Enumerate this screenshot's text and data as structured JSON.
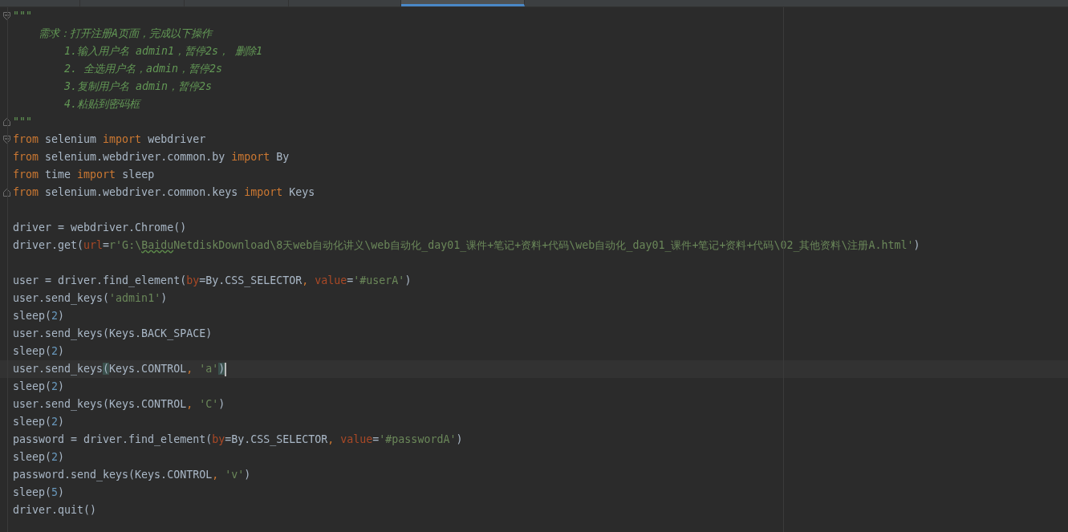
{
  "tabs": [
    {
      "selected": false
    },
    {
      "selected": false
    },
    {
      "selected": false
    },
    {
      "selected": false
    },
    {
      "selected": true
    }
  ],
  "editor": {
    "lines": [
      {
        "kind": "code",
        "current": false,
        "gutter": {
          "kind": "fold-start"
        },
        "tokens": [
          {
            "kind": "doc",
            "text": "\"\"\""
          }
        ]
      },
      {
        "kind": "code",
        "current": false,
        "tokens": [
          {
            "kind": "doc",
            "text": "    需求：打开注册A页面，完成以下操作"
          }
        ]
      },
      {
        "kind": "code",
        "current": false,
        "tokens": [
          {
            "kind": "doc",
            "text": "        1.输入用户名 admin1，暂停2s， 删除1"
          }
        ]
      },
      {
        "kind": "code",
        "current": false,
        "tokens": [
          {
            "kind": "doc",
            "text": "        2. 全选用户名，admin，暂停2s"
          }
        ]
      },
      {
        "kind": "code",
        "current": false,
        "tokens": [
          {
            "kind": "doc",
            "text": "        3.复制用户名 admin，暂停2s"
          }
        ]
      },
      {
        "kind": "code",
        "current": false,
        "tokens": [
          {
            "kind": "doc",
            "text": "        4.粘贴到密码框"
          }
        ]
      },
      {
        "kind": "code",
        "current": false,
        "gutter": {
          "kind": "fold-end"
        },
        "tokens": [
          {
            "kind": "doc",
            "text": "\"\"\""
          }
        ]
      },
      {
        "kind": "code",
        "current": false,
        "gutter": {
          "kind": "fold-start"
        },
        "tokens": [
          {
            "kind": "kw",
            "text": "from"
          },
          {
            "kind": "plain",
            "text": " selenium "
          },
          {
            "kind": "kw",
            "text": "import"
          },
          {
            "kind": "plain",
            "text": " webdriver"
          }
        ]
      },
      {
        "kind": "code",
        "current": false,
        "tokens": [
          {
            "kind": "kw",
            "text": "from"
          },
          {
            "kind": "plain",
            "text": " selenium.webdriver.common.by "
          },
          {
            "kind": "kw",
            "text": "import"
          },
          {
            "kind": "plain",
            "text": " By"
          }
        ]
      },
      {
        "kind": "code",
        "current": false,
        "tokens": [
          {
            "kind": "kw",
            "text": "from"
          },
          {
            "kind": "plain",
            "text": " time "
          },
          {
            "kind": "kw",
            "text": "import"
          },
          {
            "kind": "plain",
            "text": " sleep"
          }
        ]
      },
      {
        "kind": "code",
        "current": false,
        "gutter": {
          "kind": "fold-end"
        },
        "tokens": [
          {
            "kind": "kw",
            "text": "from"
          },
          {
            "kind": "plain",
            "text": " selenium.webdriver.common.keys "
          },
          {
            "kind": "kw",
            "text": "import"
          },
          {
            "kind": "plain",
            "text": " Keys"
          }
        ]
      },
      {
        "kind": "blank"
      },
      {
        "kind": "code",
        "current": false,
        "tokens": [
          {
            "kind": "plain",
            "text": "driver = webdriver.Chrome()"
          }
        ]
      },
      {
        "kind": "code",
        "current": false,
        "tokens": [
          {
            "kind": "plain",
            "text": "driver.get("
          },
          {
            "kind": "param",
            "text": "url"
          },
          {
            "kind": "plain",
            "text": "="
          },
          {
            "kind": "str",
            "text": "r'G:\\"
          },
          {
            "kind": "typo",
            "text": "Baidu"
          },
          {
            "kind": "str",
            "text": "NetdiskDownload\\8天web自动化讲义\\web自动化_day01_课件+笔记+资料+代码\\web自动化_day01_课件+笔记+资料+代码\\02_其他资料\\注册A.html'"
          },
          {
            "kind": "plain",
            "text": ")"
          }
        ]
      },
      {
        "kind": "blank"
      },
      {
        "kind": "code",
        "current": false,
        "tokens": [
          {
            "kind": "plain",
            "text": "user = driver.find_element("
          },
          {
            "kind": "param",
            "text": "by"
          },
          {
            "kind": "plain",
            "text": "=By.CSS_SELECTOR"
          },
          {
            "kind": "kw",
            "text": ", "
          },
          {
            "kind": "param",
            "text": "value"
          },
          {
            "kind": "plain",
            "text": "="
          },
          {
            "kind": "str",
            "text": "'#userA'"
          },
          {
            "kind": "plain",
            "text": ")"
          }
        ]
      },
      {
        "kind": "code",
        "current": false,
        "tokens": [
          {
            "kind": "plain",
            "text": "user.send_keys("
          },
          {
            "kind": "str",
            "text": "'admin1'"
          },
          {
            "kind": "plain",
            "text": ")"
          }
        ]
      },
      {
        "kind": "code",
        "current": false,
        "tokens": [
          {
            "kind": "plain",
            "text": "sleep("
          },
          {
            "kind": "num",
            "text": "2"
          },
          {
            "kind": "plain",
            "text": ")"
          }
        ]
      },
      {
        "kind": "code",
        "current": false,
        "tokens": [
          {
            "kind": "plain",
            "text": "user.send_keys(Keys.BACK_SPACE)"
          }
        ]
      },
      {
        "kind": "code",
        "current": false,
        "tokens": [
          {
            "kind": "plain",
            "text": "sleep("
          },
          {
            "kind": "num",
            "text": "2"
          },
          {
            "kind": "plain",
            "text": ")"
          }
        ]
      },
      {
        "kind": "code",
        "current": true,
        "tokens": [
          {
            "kind": "plain",
            "text": "user.send_keys"
          },
          {
            "kind": "match",
            "text": "("
          },
          {
            "kind": "plain",
            "text": "Keys.CONTROL"
          },
          {
            "kind": "kw",
            "text": ", "
          },
          {
            "kind": "str",
            "text": "'a'"
          },
          {
            "kind": "match",
            "text": ")"
          }
        ]
      },
      {
        "kind": "code",
        "current": false,
        "tokens": [
          {
            "kind": "plain",
            "text": "sleep("
          },
          {
            "kind": "num",
            "text": "2"
          },
          {
            "kind": "plain",
            "text": ")"
          }
        ]
      },
      {
        "kind": "code",
        "current": false,
        "tokens": [
          {
            "kind": "plain",
            "text": "user.send_keys(Keys.CONTROL"
          },
          {
            "kind": "kw",
            "text": ", "
          },
          {
            "kind": "str",
            "text": "'C'"
          },
          {
            "kind": "plain",
            "text": ")"
          }
        ]
      },
      {
        "kind": "code",
        "current": false,
        "tokens": [
          {
            "kind": "plain",
            "text": "sleep("
          },
          {
            "kind": "num",
            "text": "2"
          },
          {
            "kind": "plain",
            "text": ")"
          }
        ]
      },
      {
        "kind": "code",
        "current": false,
        "tokens": [
          {
            "kind": "plain",
            "text": "password = driver.find_element("
          },
          {
            "kind": "param",
            "text": "by"
          },
          {
            "kind": "plain",
            "text": "=By.CSS_SELECTOR"
          },
          {
            "kind": "kw",
            "text": ", "
          },
          {
            "kind": "param",
            "text": "value"
          },
          {
            "kind": "plain",
            "text": "="
          },
          {
            "kind": "str",
            "text": "'#passwordA'"
          },
          {
            "kind": "plain",
            "text": ")"
          }
        ]
      },
      {
        "kind": "code",
        "current": false,
        "tokens": [
          {
            "kind": "plain",
            "text": "sleep("
          },
          {
            "kind": "num",
            "text": "2"
          },
          {
            "kind": "plain",
            "text": ")"
          }
        ]
      },
      {
        "kind": "code",
        "current": false,
        "tokens": [
          {
            "kind": "plain",
            "text": "password.send_keys(Keys.CONTROL"
          },
          {
            "kind": "kw",
            "text": ", "
          },
          {
            "kind": "str",
            "text": "'v'"
          },
          {
            "kind": "plain",
            "text": ")"
          }
        ]
      },
      {
        "kind": "code",
        "current": false,
        "tokens": [
          {
            "kind": "plain",
            "text": "sleep("
          },
          {
            "kind": "num",
            "text": "5"
          },
          {
            "kind": "plain",
            "text": ")"
          }
        ]
      },
      {
        "kind": "code",
        "current": false,
        "tokens": [
          {
            "kind": "plain",
            "text": "driver.quit()"
          }
        ]
      }
    ]
  }
}
